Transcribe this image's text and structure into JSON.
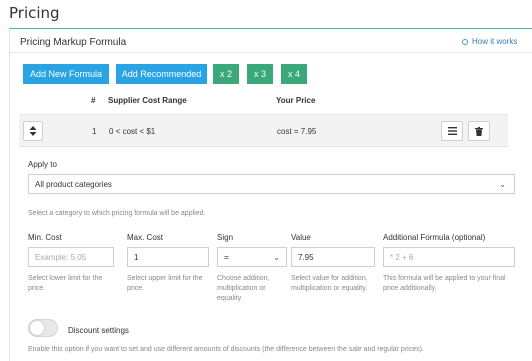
{
  "page": {
    "title": "Pricing"
  },
  "card": {
    "title": "Pricing Markup Formula",
    "how_link": "How it works"
  },
  "buttons": {
    "add_new": "Add New Formula",
    "add_recommended": "Add Recommended",
    "x2": "x 2",
    "x3": "x 3",
    "x4": "x 4"
  },
  "table": {
    "headers": [
      "#",
      "Supplier Cost Range",
      "Your Price"
    ],
    "rows": [
      {
        "index": "1",
        "range": "0 < cost < $1",
        "price": "cost = 7.95"
      }
    ]
  },
  "apply_to": {
    "label": "Apply to",
    "value": "All product categories",
    "help": "Select a category to which pricing formula will be applied."
  },
  "fields": {
    "min_cost": {
      "label": "Min. Cost",
      "value": "",
      "placeholder": "Example: 5.05",
      "help": "Select lower limit for the price."
    },
    "max_cost": {
      "label": "Max. Cost",
      "value": "1",
      "help": "Select upper limit for the price."
    },
    "sign": {
      "label": "Sign",
      "value": "=",
      "help": "Choose addition, multiplication or equality."
    },
    "value": {
      "label": "Value",
      "value": "7.95",
      "help": "Select value for addition, multiplication or equality."
    },
    "additional": {
      "label": "Additional Formula (optional)",
      "value": "",
      "placeholder": "* 2 + 6",
      "help": "This formula will be applied to your final price additionally."
    }
  },
  "discount": {
    "label": "Discount settings",
    "enabled": false,
    "help": "Enable this option if you want to set and use different amounts of discounts (the difference between the sale and regular prices)."
  },
  "colors": {
    "accent_teal": "#4fb4a3",
    "button_blue": "#29a3e3",
    "button_green": "#3ba87a",
    "link_blue": "#3a7ab5"
  },
  "icons": [
    "info-circle-icon",
    "sort-arrows-icon",
    "menu-icon",
    "trash-icon",
    "chevron-down-icon"
  ]
}
